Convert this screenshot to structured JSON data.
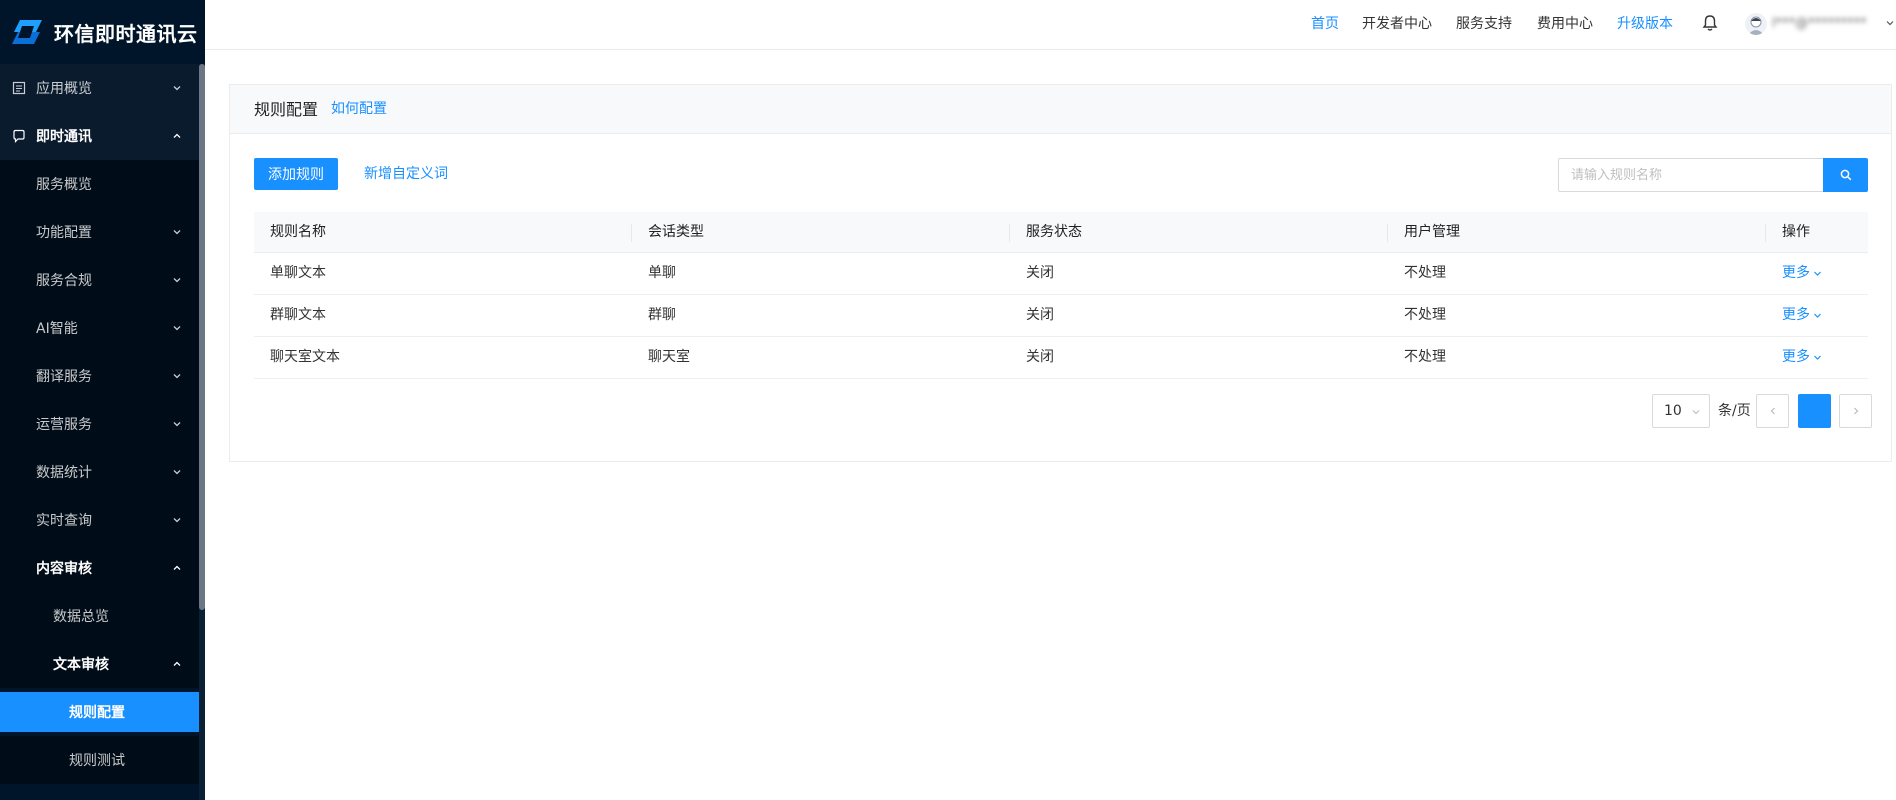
{
  "brand": {
    "name": "环信即时通讯云"
  },
  "sidebar": {
    "items": [
      {
        "label": "应用概览",
        "icon": "app-overview-icon",
        "expanded": false
      },
      {
        "label": "即时通讯",
        "icon": "chat-bubble-icon",
        "expanded": true
      },
      {
        "label": "服务概览"
      },
      {
        "label": "功能配置",
        "expanded": false
      },
      {
        "label": "服务合规",
        "expanded": false
      },
      {
        "label": "AI智能",
        "expanded": false
      },
      {
        "label": "翻译服务",
        "expanded": false
      },
      {
        "label": "运营服务",
        "expanded": false
      },
      {
        "label": "数据统计",
        "expanded": false
      },
      {
        "label": "实时查询",
        "expanded": false
      },
      {
        "label": "内容审核",
        "expanded": true
      },
      {
        "label": "数据总览"
      },
      {
        "label": "文本审核",
        "expanded": true
      },
      {
        "label": "规则配置",
        "active": true
      },
      {
        "label": "规则测试"
      }
    ]
  },
  "topnav": {
    "home": "首页",
    "developer": "开发者中心",
    "support": "服务支持",
    "billing": "费用中心",
    "upgrade": "升级版本",
    "username": "l***@*********"
  },
  "page": {
    "title": "规则配置",
    "help_link": "如何配置",
    "add_rule": "添加规则",
    "add_custom_word": "新增自定义词",
    "search_placeholder": "请输入规则名称"
  },
  "table": {
    "columns": [
      "规则名称",
      "会话类型",
      "服务状态",
      "用户管理",
      "操作"
    ],
    "rows": [
      {
        "name": "单聊文本",
        "type": "单聊",
        "status": "关闭",
        "user": "不处理",
        "action": "更多"
      },
      {
        "name": "群聊文本",
        "type": "群聊",
        "status": "关闭",
        "user": "不处理",
        "action": "更多"
      },
      {
        "name": "聊天室文本",
        "type": "聊天室",
        "status": "关闭",
        "user": "不处理",
        "action": "更多"
      }
    ]
  },
  "pagination": {
    "page_size": "10",
    "per_page_label": "条/页",
    "current_page": ""
  },
  "colors": {
    "accent": "#1890ff",
    "sidebar_bg": "#001529"
  }
}
